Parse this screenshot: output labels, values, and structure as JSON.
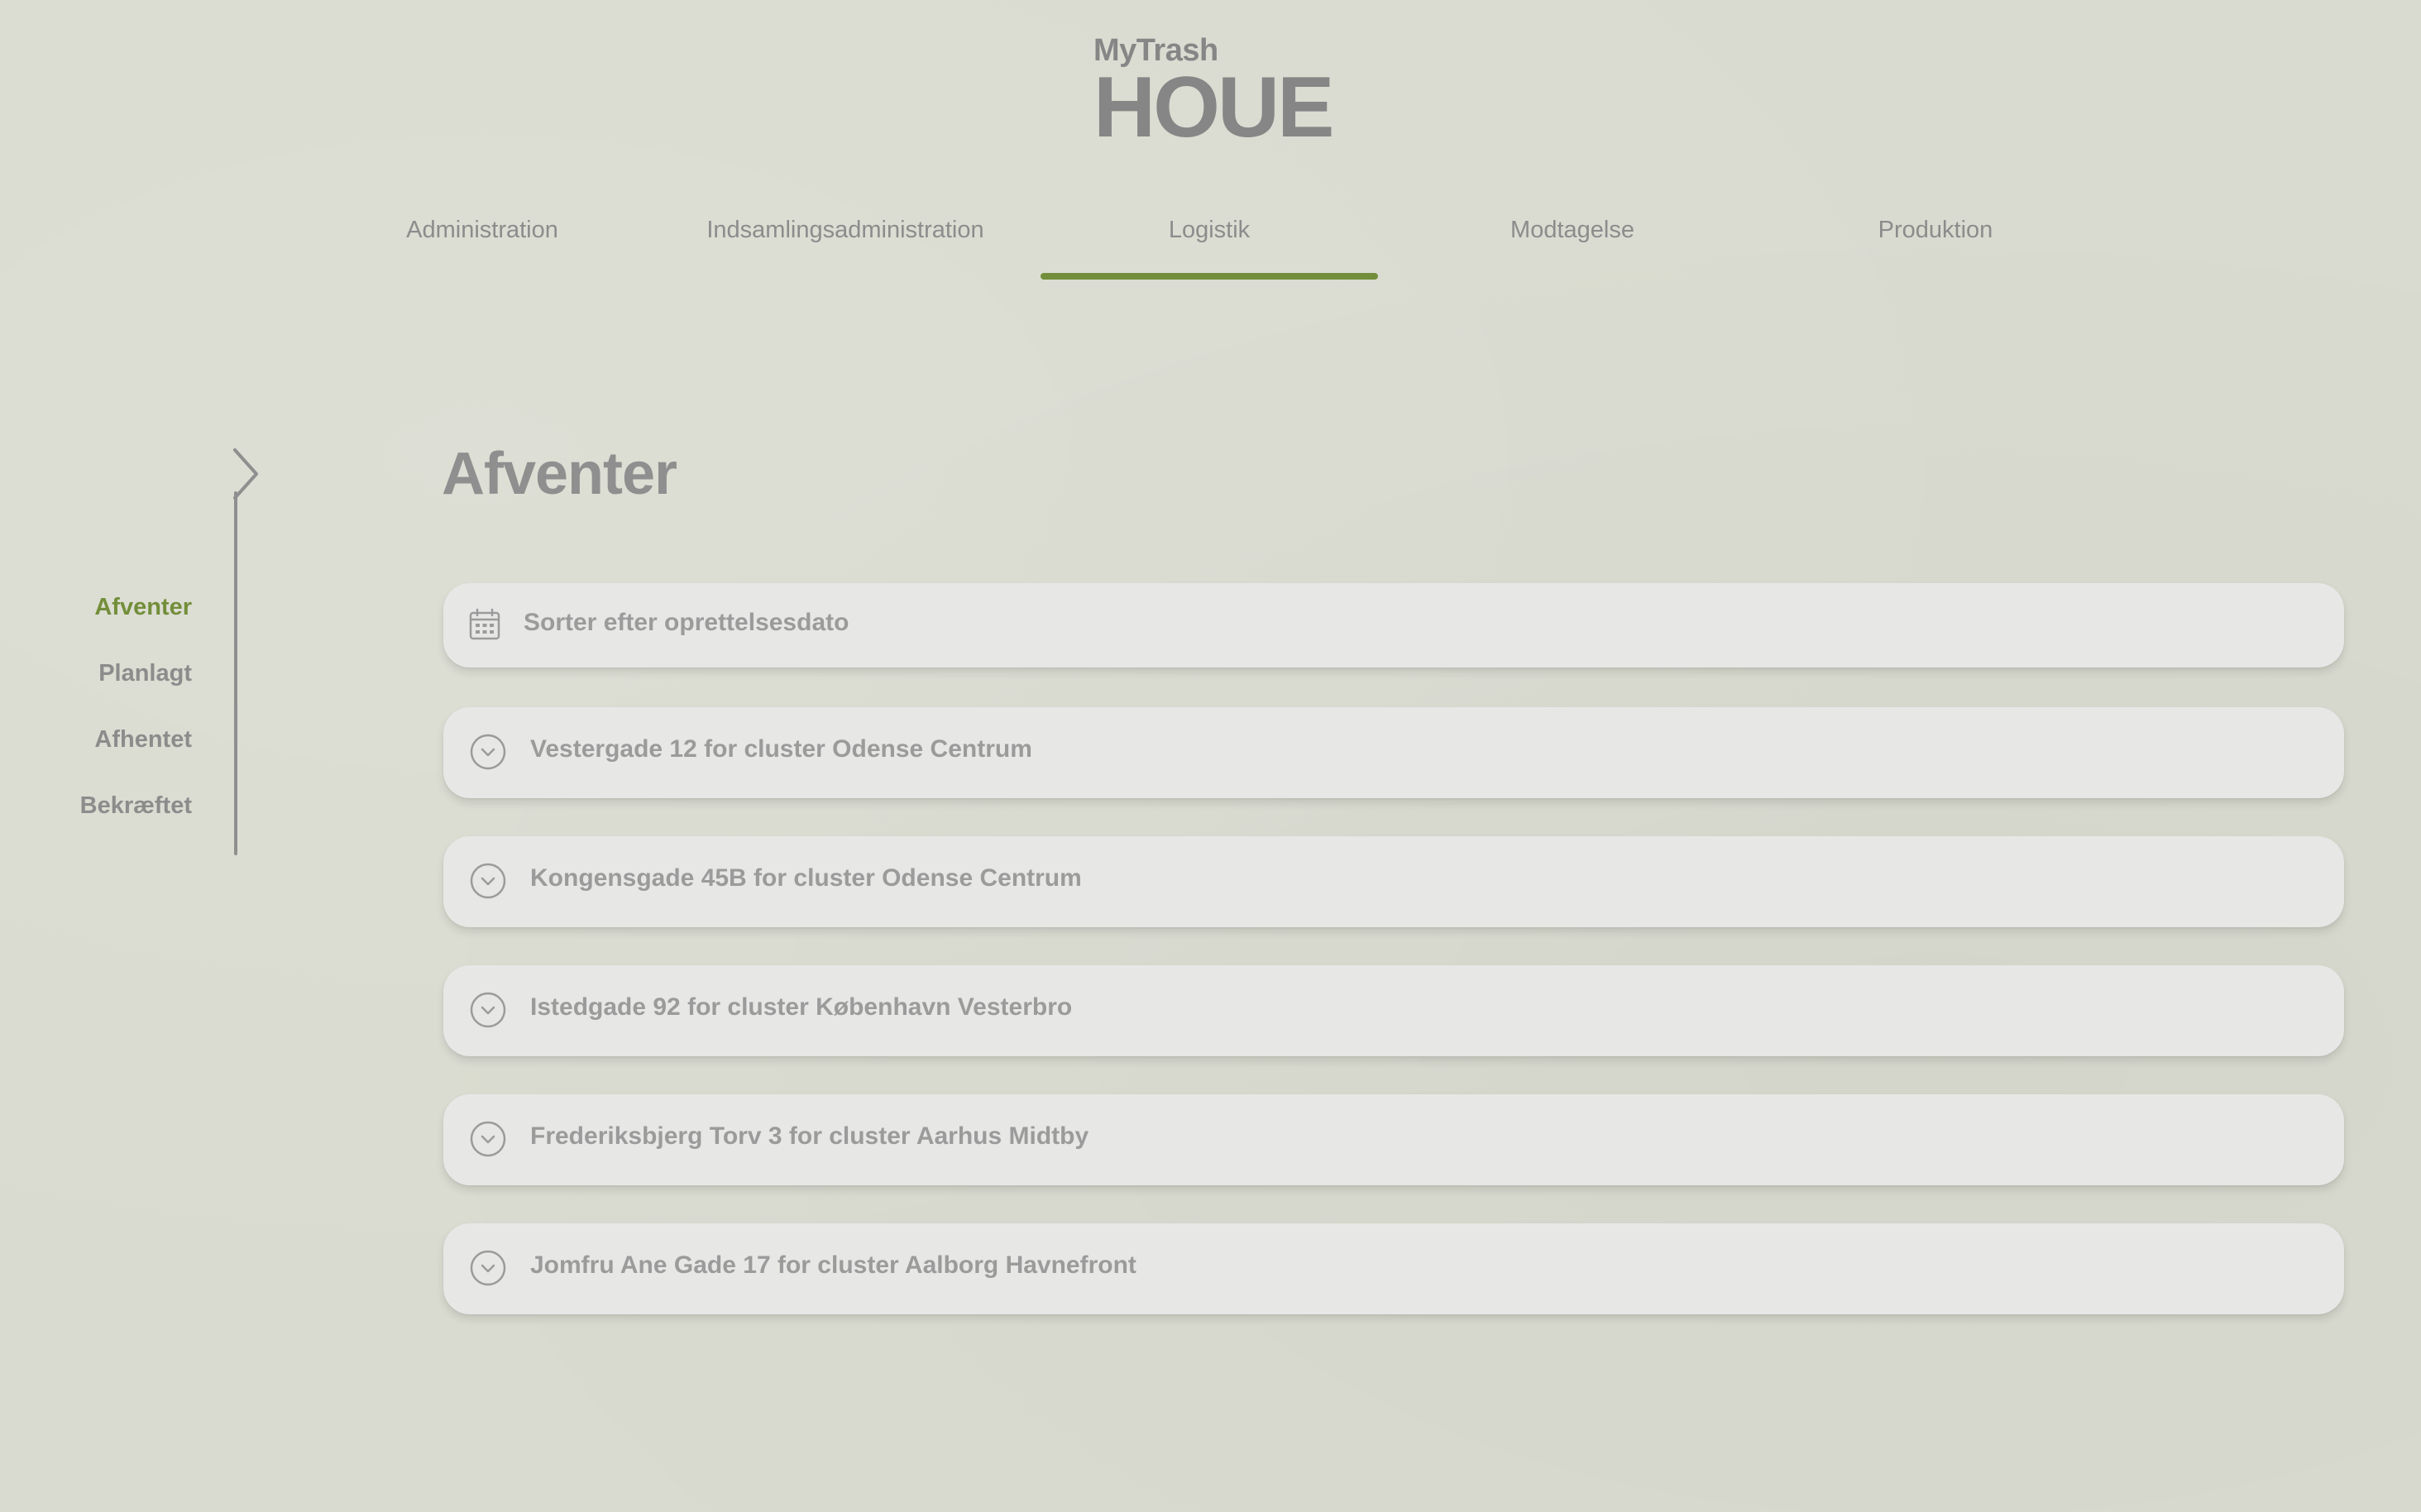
{
  "logo": {
    "top": "MyTrash",
    "main": "HOUE"
  },
  "nav": {
    "items": [
      {
        "label": "Administration",
        "active": false
      },
      {
        "label": "Indsamlingsadministration",
        "active": false
      },
      {
        "label": "Logistik",
        "active": true
      },
      {
        "label": "Modtagelse",
        "active": false
      },
      {
        "label": "Produktion",
        "active": false
      }
    ],
    "accent_color": "#738e3a"
  },
  "sidebar": {
    "items": [
      {
        "label": "Afventer",
        "active": true
      },
      {
        "label": "Planlagt",
        "active": false
      },
      {
        "label": "Afhentet",
        "active": false
      },
      {
        "label": "Bekræftet",
        "active": false
      }
    ],
    "toggle_icon": "chevron-right-icon"
  },
  "main": {
    "title": "Afventer",
    "sort": {
      "icon": "calendar-icon",
      "label": "Sorter efter oprettelsesdato"
    },
    "items": [
      {
        "label": "Vestergade 12 for cluster Odense Centrum"
      },
      {
        "label": "Kongensgade 45B for cluster Odense Centrum"
      },
      {
        "label": "Istedgade 92 for cluster København Vesterbro"
      },
      {
        "label": "Frederiksbjerg Torv 3 for cluster Aarhus Midtby"
      },
      {
        "label": "Jomfru Ane Gade 17 for cluster Aalborg Havnefront"
      }
    ],
    "item_icon": "chevron-down-circle-icon"
  },
  "colors": {
    "background": "#d9dbd0",
    "card": "#e7e7e6",
    "text_muted": "#8c8c8c",
    "accent": "#738e3a"
  }
}
